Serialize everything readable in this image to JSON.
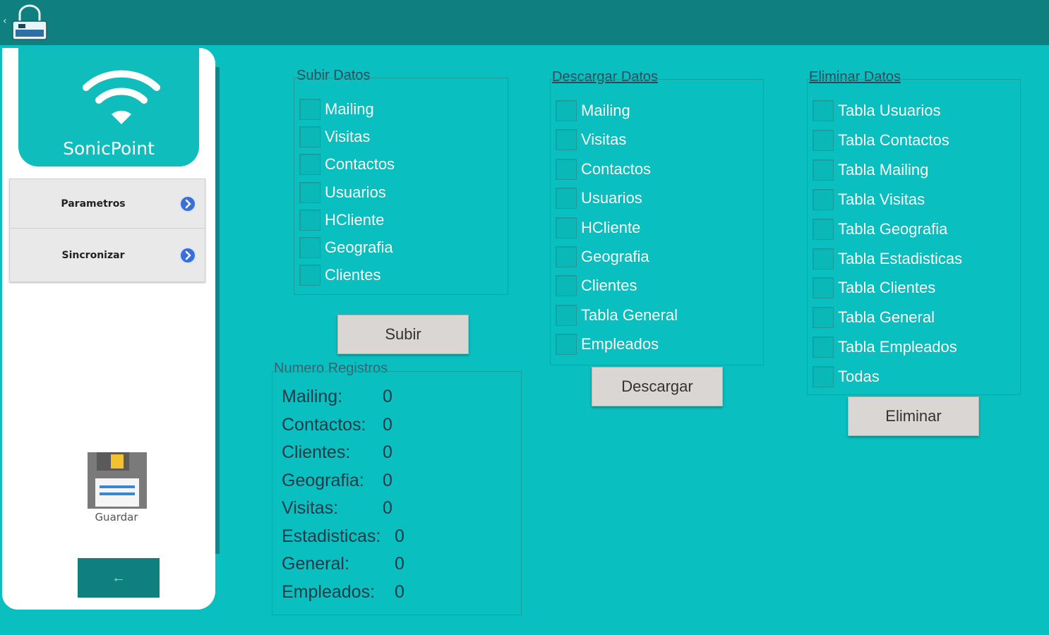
{
  "topbar": {
    "back_glyph": "‹",
    "logo_icon": "lock-logo-icon"
  },
  "sidebar": {
    "brand": "SonicPoint",
    "menu": [
      {
        "label": "Parametros",
        "icon": "chevron-right-circle-icon"
      },
      {
        "label": "Sincronizar",
        "icon": "chevron-right-circle-icon"
      }
    ],
    "save_label": "Guardar",
    "back_glyph": "←"
  },
  "upload": {
    "title": "Subir Datos",
    "items": [
      "Mailing",
      "Visitas",
      "Contactos",
      "Usuarios",
      "HCliente",
      "Geografia",
      "Clientes"
    ],
    "button": "Subir"
  },
  "download": {
    "title": "Descargar Datos",
    "items": [
      "Mailing",
      "Visitas",
      "Contactos",
      "Usuarios",
      "HCliente",
      "Geografia",
      "Clientes",
      "Tabla General",
      "Empleados"
    ],
    "button": "Descargar"
  },
  "delete": {
    "title": "Eliminar Datos",
    "items": [
      "Tabla Usuarios",
      "Tabla Contactos",
      "Tabla Mailing",
      "Tabla Visitas",
      "Tabla Geografia",
      "Tabla Estadisticas",
      "Tabla Clientes",
      "Tabla General",
      "Tabla Empleados",
      "Todas"
    ],
    "button": "Eliminar"
  },
  "counts": {
    "title": "Numero Registros",
    "rows": [
      {
        "label": "Mailing:",
        "value": "0"
      },
      {
        "label": "Contactos:",
        "value": "0"
      },
      {
        "label": "Clientes:",
        "value": "0"
      },
      {
        "label": "Geografia:",
        "value": "0"
      },
      {
        "label": "Visitas:",
        "value": "0"
      },
      {
        "label": "Estadisticas:",
        "value": "0"
      },
      {
        "label": "General:",
        "value": "0"
      },
      {
        "label": "Empleados:",
        "value": "0"
      }
    ]
  },
  "colors": {
    "background": "#09bfbf",
    "topbar": "#0f7f7f",
    "brand_card": "#0fbdbd",
    "button": "#d9d6d3"
  }
}
